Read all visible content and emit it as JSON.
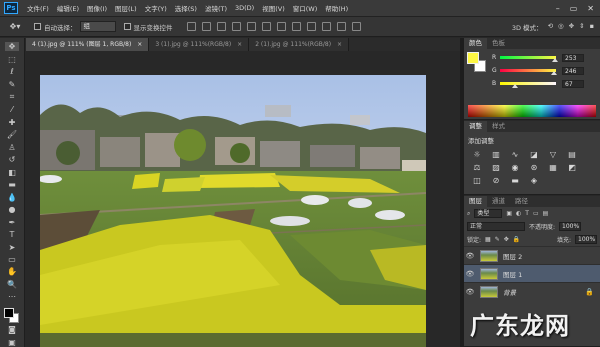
{
  "app": {
    "logo": "Ps"
  },
  "menu": [
    "文件(F)",
    "编辑(E)",
    "图像(I)",
    "图层(L)",
    "文字(Y)",
    "选择(S)",
    "滤镜(T)",
    "3D(D)",
    "视图(V)",
    "窗口(W)",
    "帮助(H)"
  ],
  "window_controls": {
    "minimize": "–",
    "restore": "▭",
    "close": "✕"
  },
  "options": {
    "auto_select_label": "自动选择：",
    "auto_select_value": "组",
    "show_transform_label": "显示变换控件",
    "mode3d_label": "3D 模式："
  },
  "doc_tabs": [
    {
      "label": "4 (1).jpg @ 111% (图层 1, RGB/8)",
      "close": "×",
      "active": true
    },
    {
      "label": "3 (1).jpg @ 111%(RGB/8)",
      "close": "×",
      "active": false
    },
    {
      "label": "2 (1).jpg @ 111%(RGB/8)",
      "close": "×",
      "active": false
    }
  ],
  "color_panel": {
    "tabs": [
      "颜色",
      "色板"
    ],
    "fg_color": "#fdf643",
    "channels": [
      {
        "label": "R",
        "value": "253",
        "level": 0.99
      },
      {
        "label": "G",
        "value": "246",
        "level": 0.96
      },
      {
        "label": "B",
        "value": "67",
        "level": 0.26
      }
    ]
  },
  "adjustments_panel": {
    "tabs": [
      "调整",
      "样式"
    ],
    "title": "添加调整",
    "icons": [
      "brightness-icon",
      "levels-icon",
      "curves-icon",
      "exposure-icon",
      "vibrance-icon",
      "hue-icon",
      "colorbalance-icon",
      "bw-icon",
      "photofilter-icon",
      "channelmixer-icon",
      "colorlookup-icon",
      "invert-icon",
      "posterize-icon",
      "threshold-icon",
      "gradientmap-icon",
      "selectivecolor-icon"
    ]
  },
  "layers_panel": {
    "tabs": [
      "图层",
      "通道",
      "路径"
    ],
    "filter_label": "类型",
    "blend_mode": "正常",
    "opacity_label": "不透明度:",
    "opacity_value": "100%",
    "lock_label": "锁定:",
    "fill_label": "填充:",
    "fill_value": "100%",
    "layers": [
      {
        "name": "图层 2",
        "visible": true,
        "selected": false,
        "locked": false
      },
      {
        "name": "图层 1",
        "visible": true,
        "selected": true,
        "locked": false
      },
      {
        "name": "背景",
        "visible": true,
        "selected": false,
        "locked": true
      }
    ]
  },
  "watermark": "广东龙网"
}
